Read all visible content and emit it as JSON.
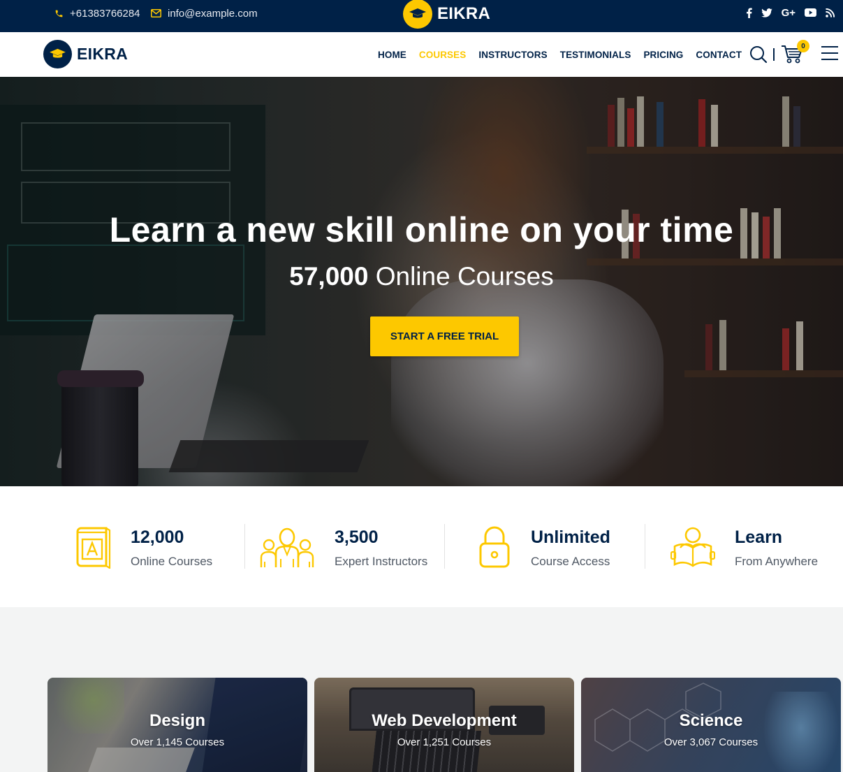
{
  "topbar": {
    "phone": "+61383766284",
    "email": "info@example.com",
    "logo_text": "EIKRA",
    "social": [
      {
        "name": "facebook-icon",
        "glyph": "f"
      },
      {
        "name": "twitter-icon",
        "glyph": "🐦"
      },
      {
        "name": "google-plus-icon",
        "glyph": "G+"
      },
      {
        "name": "youtube-icon",
        "glyph": "▶"
      },
      {
        "name": "rss-icon",
        "glyph": "))"
      }
    ]
  },
  "nav": {
    "logo_text": "EIKRA",
    "items": [
      "HOME",
      "COURSES",
      "INSTRUCTORS",
      "TESTIMONIALS",
      "PRICING",
      "CONTACT"
    ],
    "active_item": "COURSES",
    "cart_count": "0"
  },
  "hero": {
    "title": "Learn a new skill online on your time",
    "subtitle_number": "57,000",
    "subtitle_text": "Online Courses",
    "cta_label": "START A FREE TRIAL"
  },
  "features": [
    {
      "number": "12,000",
      "label": "Online Courses",
      "icon": "book-icon"
    },
    {
      "number": "3,500",
      "label": "Expert Instructors",
      "icon": "instructors-icon"
    },
    {
      "number": "Unlimited",
      "label": "Course Access",
      "icon": "lock-icon"
    },
    {
      "number": "Learn",
      "label": "From Anywhere",
      "icon": "reader-icon"
    }
  ],
  "categories": [
    {
      "title": "Design",
      "subtitle": "Over 1,145 Courses"
    },
    {
      "title": "Web Development",
      "subtitle": "Over 1,251 Courses"
    },
    {
      "title": "Science",
      "subtitle": "Over 3,067 Courses"
    }
  ],
  "colors": {
    "navy": "#002147",
    "accent": "#fdc800",
    "feature_text": "#4f5864",
    "section_bg": "#f3f4f4"
  }
}
